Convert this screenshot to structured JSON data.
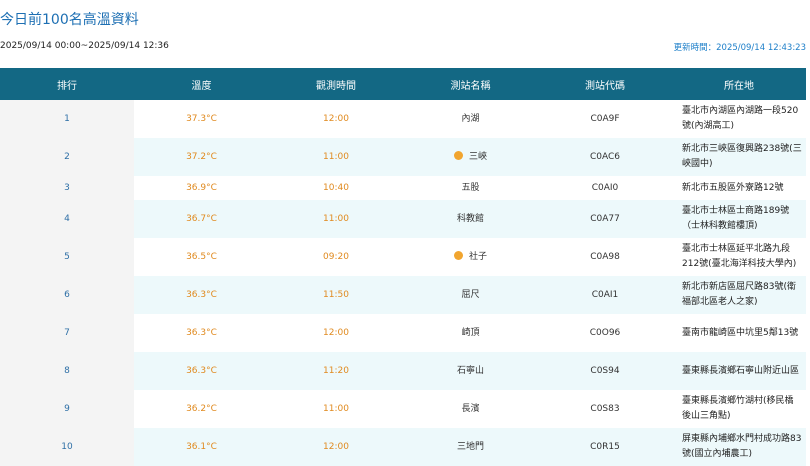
{
  "page": {
    "title": "今日前100名高溫資料",
    "range": "2025/09/14 00:00~2025/09/14 12:36",
    "updated": "更新時間：2025/09/14 12:43:23"
  },
  "table": {
    "headers": [
      "排行",
      "溫度",
      "觀測時間",
      "測站名稱",
      "測站代碼",
      "所在地"
    ],
    "rows": [
      {
        "rank": "1",
        "temp": "37.3°C",
        "time": "12:00",
        "station": "內湖",
        "warning": false,
        "code": "C0A9F",
        "location": "臺北市內湖區內湖路一段520號(內湖高工)"
      },
      {
        "rank": "2",
        "temp": "37.2°C",
        "time": "11:00",
        "station": "三峽",
        "warning": true,
        "code": "C0AC6",
        "location": "新北市三峽區復興路238號(三峽國中)"
      },
      {
        "rank": "3",
        "temp": "36.9°C",
        "time": "10:40",
        "station": "五股",
        "warning": false,
        "code": "C0AI0",
        "location": "新北市五股區外寮路12號"
      },
      {
        "rank": "4",
        "temp": "36.7°C",
        "time": "11:00",
        "station": "科教館",
        "warning": false,
        "code": "C0A77",
        "location": "臺北市士林區士商路189號（士林科教館樓頂)"
      },
      {
        "rank": "5",
        "temp": "36.5°C",
        "time": "09:20",
        "station": "社子",
        "warning": true,
        "code": "C0A98",
        "location": "臺北市士林區延平北路九段212號(臺北海洋科技大學內)"
      },
      {
        "rank": "6",
        "temp": "36.3°C",
        "time": "11:50",
        "station": "屈尺",
        "warning": false,
        "code": "C0AI1",
        "location": "新北市新店區屈尺路83號(衛福部北區老人之家)"
      },
      {
        "rank": "7",
        "temp": "36.3°C",
        "time": "12:00",
        "station": "崎頂",
        "warning": false,
        "code": "C0O96",
        "location": "臺南市龍崎區中坑里5鄰13號"
      },
      {
        "rank": "8",
        "temp": "36.3°C",
        "time": "11:20",
        "station": "石寧山",
        "warning": false,
        "code": "C0S94",
        "location": "臺東縣長濱鄉石寧山附近山區"
      },
      {
        "rank": "9",
        "temp": "36.2°C",
        "time": "11:00",
        "station": "長濱",
        "warning": false,
        "code": "C0S83",
        "location": "臺東縣長濱鄉竹湖村(移民橋後山三角點)"
      },
      {
        "rank": "10",
        "temp": "36.1°C",
        "time": "12:00",
        "station": "三地門",
        "warning": false,
        "code": "C0R15",
        "location": "屏東縣內埔鄉水門村成功路83號(國立內埔農工)"
      }
    ]
  }
}
